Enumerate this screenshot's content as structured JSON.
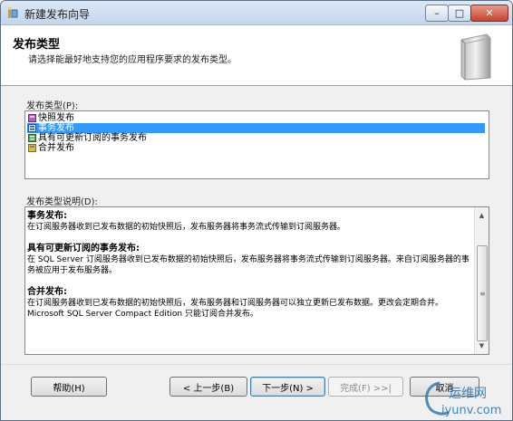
{
  "window": {
    "title": "新建发布向导",
    "icon": "wizard-icon",
    "controls": {
      "minimize": "–",
      "maximize": "□",
      "close": "✕"
    }
  },
  "header": {
    "title": "发布类型",
    "description": "请选择能最好地支持您的应用程序要求的发布类型。",
    "graphic": "server-graphic"
  },
  "publication_types": {
    "label": "发布类型(P):",
    "items": [
      {
        "label": "快照发布",
        "icon": "snapshot-publication-icon",
        "selected": false
      },
      {
        "label": "事务发布",
        "icon": "transactional-publication-icon",
        "selected": true
      },
      {
        "label": "具有可更新订阅的事务发布",
        "icon": "updatable-transactional-icon",
        "selected": false
      },
      {
        "label": "合并发布",
        "icon": "merge-publication-icon",
        "selected": false
      }
    ]
  },
  "description_box": {
    "label": "发布类型说明(D):",
    "sections": [
      {
        "heading": "事务发布:",
        "text": "在订阅服务器收到已发布数据的初始快照后，发布服务器将事务流式传输到订阅服务器。"
      },
      {
        "heading": "具有可更新订阅的事务发布:",
        "text": "在 SQL Server 订阅服务器收到已发布数据的初始快照后，发布服务器将事务流式传输到订阅服务器。来自订阅服务器的事务被应用于发布服务器。"
      },
      {
        "heading": "合并发布:",
        "text": "在订阅服务器收到已发布数据的初始快照后，发布服务器和订阅服务器可以独立更新已发布数据。更改会定期合并。Microsoft SQL Server Compact Edition 只能订阅合并发布。"
      }
    ]
  },
  "buttons": {
    "help": "帮助(H)",
    "back": "< 上一步(B)",
    "next": "下一步(N) >",
    "finish": "完成(F) >>|",
    "cancel": "取消"
  },
  "watermark": {
    "line1": "运维网",
    "line2": "iyunv.com"
  }
}
